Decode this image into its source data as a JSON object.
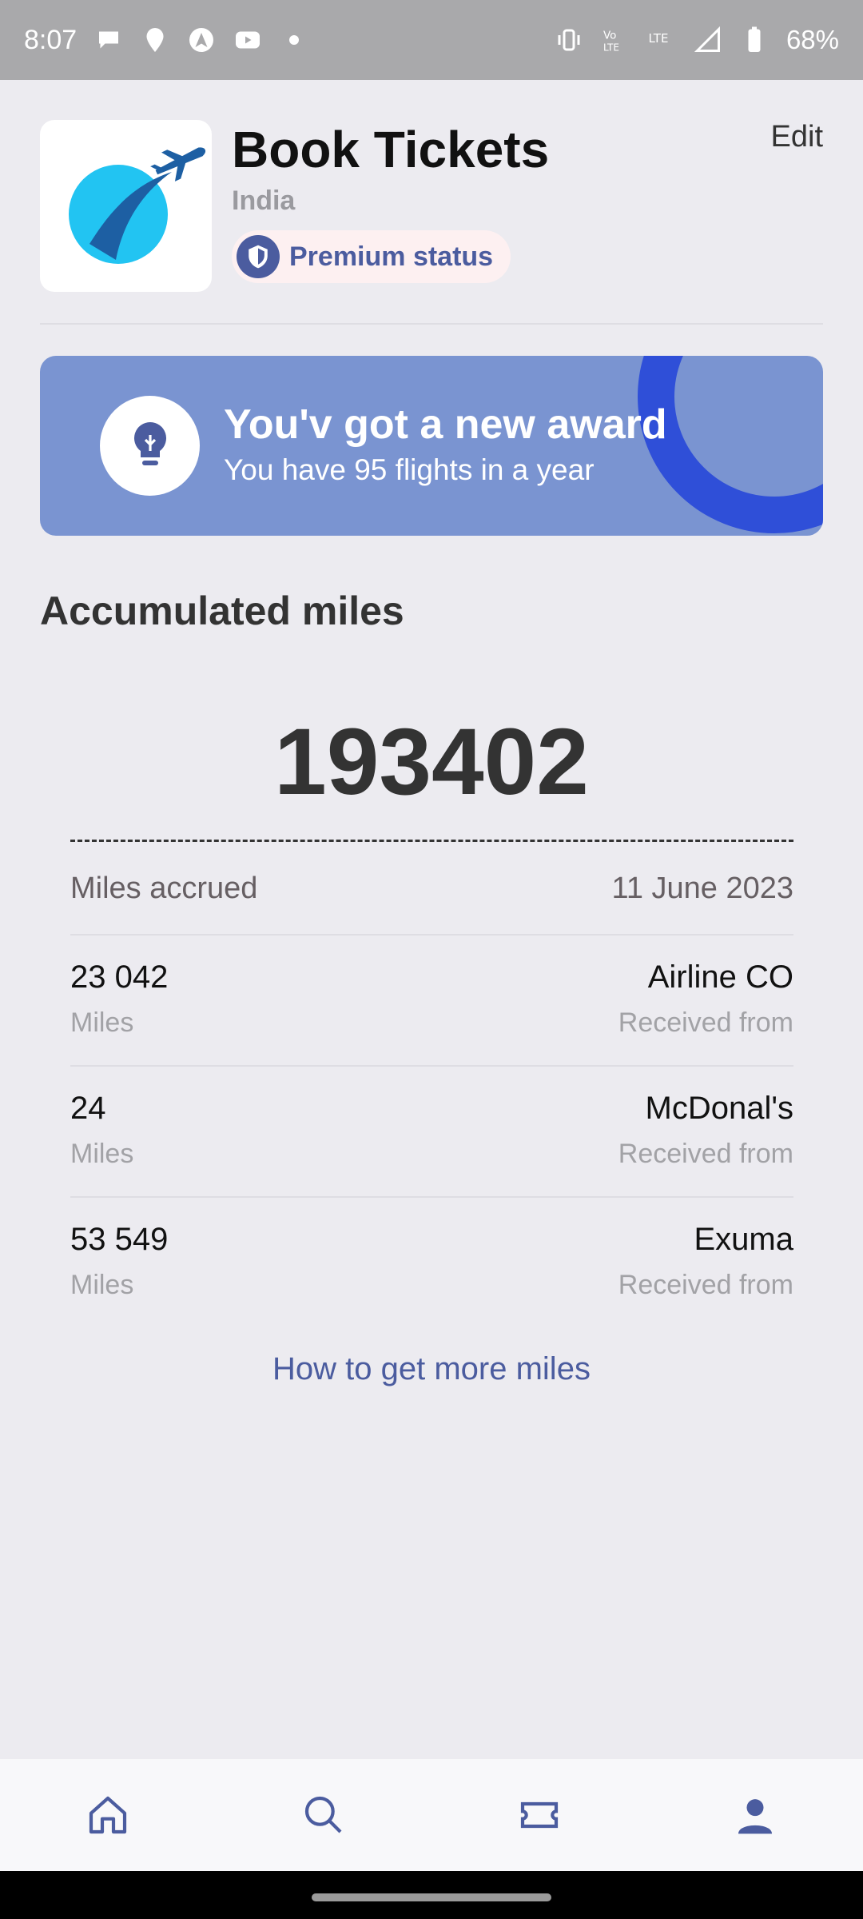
{
  "status_bar": {
    "time": "8:07",
    "battery": "68%",
    "icons_left": [
      "chat-icon",
      "location-icon",
      "maps-icon",
      "youtube-icon",
      "dot-icon"
    ],
    "icons_right": [
      "vibrate-icon",
      "volte-icon",
      "lte-icon",
      "signal-icon",
      "battery-icon"
    ]
  },
  "header": {
    "title": "Book Tickets",
    "subtitle": "India",
    "badge": "Premium status",
    "edit": "Edit"
  },
  "award": {
    "title": "You'v got a new award",
    "subtitle": "You have 95 flights in a year"
  },
  "miles": {
    "section_title": "Accumulated miles",
    "total": "193402",
    "accrued_label": "Miles accrued",
    "accrued_date": "11 June 2023",
    "entries": [
      {
        "amount": "23 042",
        "unit": "Miles",
        "source": "Airline CO",
        "received": "Received from"
      },
      {
        "amount": "24",
        "unit": "Miles",
        "source": "McDonal's",
        "received": "Received from"
      },
      {
        "amount": "53 549",
        "unit": "Miles",
        "source": "Exuma",
        "received": "Received from"
      }
    ],
    "more_link": "How to get more miles"
  },
  "colors": {
    "accent": "#4b5c9f",
    "banner": "#7a94d1",
    "banner_ring": "#2f4fd8",
    "background": "#ecebf0"
  },
  "bottom_nav": [
    "home-icon",
    "search-icon",
    "ticket-icon",
    "profile-icon"
  ]
}
